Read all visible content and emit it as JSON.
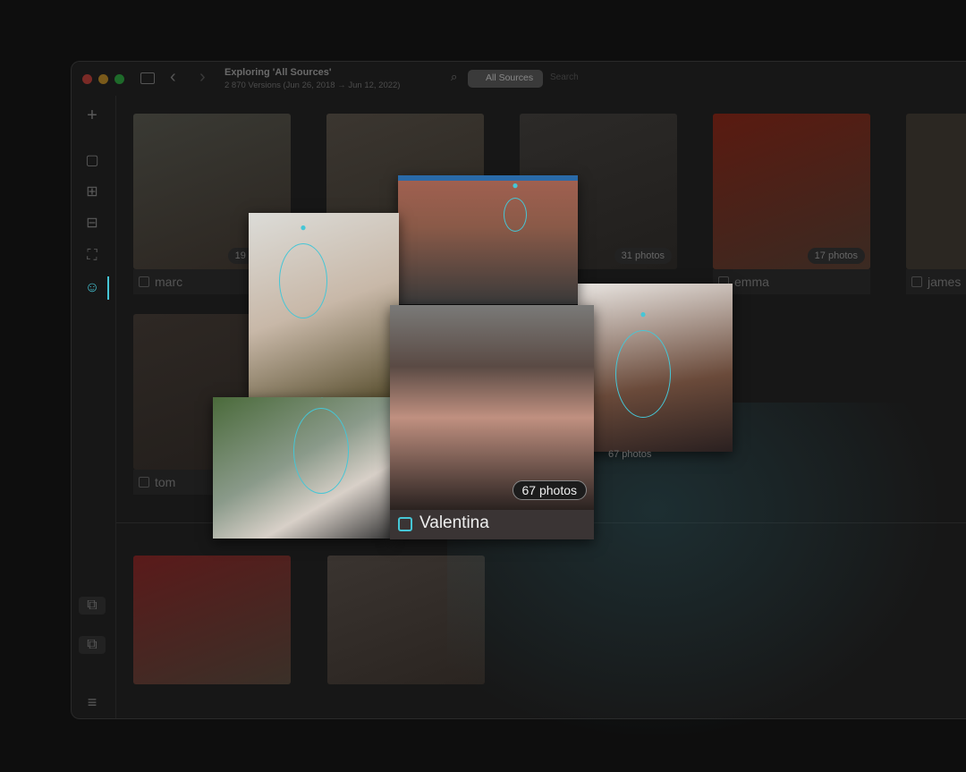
{
  "titlebar": {
    "title": "Exploring 'All Sources'",
    "subtitle": "2 870 Versions (Jun 26, 2018 → Jun 12, 2022)",
    "source_button": "All Sources",
    "search_placeholder": "Search"
  },
  "sidebar": {
    "items": [
      "add-icon",
      "square-icon",
      "grid-icon",
      "album-add-icon",
      "map-icon",
      "people-icon"
    ],
    "active": "people-icon",
    "bottom": [
      "import-icon",
      "export-icon",
      "menu-icon"
    ]
  },
  "people": [
    {
      "name": "marc",
      "count": "19 photos"
    },
    {
      "name": "",
      "count": ""
    },
    {
      "name": "",
      "count": "31 photos"
    },
    {
      "name": "emma",
      "count": "17 photos"
    },
    {
      "name": "james",
      "count": ""
    },
    {
      "name": "tom",
      "count": ""
    },
    {
      "name": "",
      "count": "67 photos"
    }
  ],
  "featured": {
    "name": "Valentina",
    "count": "67 photos"
  },
  "colors": {
    "accent": "#46c6d6"
  }
}
